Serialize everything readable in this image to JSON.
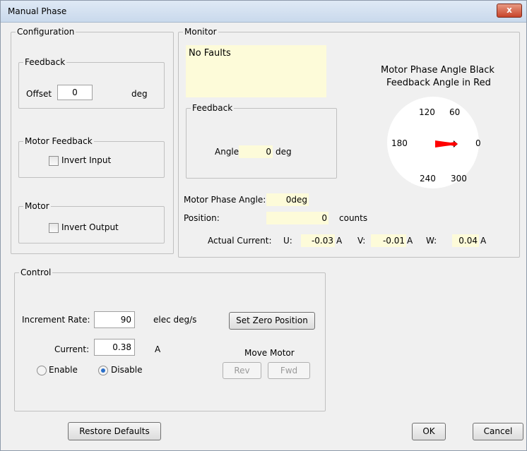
{
  "window": {
    "title": "Manual Phase",
    "close_glyph": "x"
  },
  "configuration": {
    "title": "Configuration",
    "feedback": {
      "title": "Feedback",
      "offset_label": "Offset",
      "offset_value": "0",
      "offset_unit": "deg"
    },
    "motor_feedback": {
      "title": "Motor Feedback",
      "invert_input_label": "Invert Input",
      "invert_input_checked": false
    },
    "motor": {
      "title": "Motor",
      "invert_output_label": "Invert Output",
      "invert_output_checked": false
    }
  },
  "monitor": {
    "title": "Monitor",
    "faults_text": "No Faults",
    "feedback": {
      "title": "Feedback",
      "angle_label": "Angle",
      "angle_value": "0",
      "angle_unit": "deg"
    },
    "dial": {
      "caption_line1": "Motor Phase Angle Black",
      "caption_line2": "Feedback Angle in Red",
      "labels": {
        "a120": "120",
        "a60": "60",
        "a180": "180",
        "a0": "0",
        "a240": "240",
        "a300": "300"
      },
      "motor_phase_angle_deg": 0,
      "feedback_angle_deg": 0,
      "motor_color": "#000000",
      "feedback_color": "#ff0000"
    },
    "motor_phase_angle_label": "Motor Phase Angle:",
    "motor_phase_angle_value": "0deg",
    "position_label": "Position:",
    "position_value": "0",
    "position_unit": "counts",
    "actual_current_label": "Actual Current:",
    "u_label": "U:",
    "u_value": "-0.03",
    "u_unit": "A",
    "v_label": "V:",
    "v_value": "-0.01",
    "v_unit": "A",
    "w_label": "W:",
    "w_value": "0.04",
    "w_unit": "A"
  },
  "control": {
    "title": "Control",
    "increment_rate_label": "Increment Rate:",
    "increment_rate_value": "90",
    "increment_rate_unit": "elec deg/s",
    "set_zero_label": "Set Zero Position",
    "current_label": "Current:",
    "current_value": "0.38",
    "current_unit": "A",
    "enable_label": "Enable",
    "disable_label": "Disable",
    "mode_selected": "Disable",
    "move_motor_label": "Move Motor",
    "rev_label": "Rev",
    "fwd_label": "Fwd"
  },
  "footer": {
    "restore_defaults_label": "Restore Defaults",
    "ok_label": "OK",
    "cancel_label": "Cancel"
  },
  "colors": {
    "readout_bg": "#fdfbd9",
    "titlebar": "#dfe9f5",
    "close_button": "#c8442a"
  }
}
